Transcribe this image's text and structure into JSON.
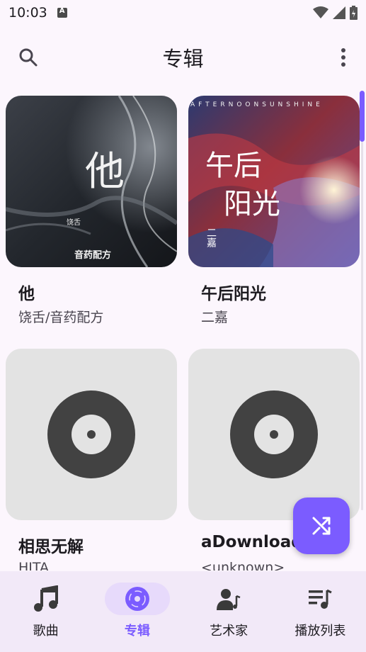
{
  "status_bar": {
    "time": "10:03"
  },
  "top_bar": {
    "title": "专辑"
  },
  "albums": [
    {
      "title": "他",
      "artist": "饶舌/音药配方",
      "cover_text": "他",
      "cover_sub": "饶舌",
      "cover_brand": "音药配方"
    },
    {
      "title": "午后阳光",
      "artist": "二嘉",
      "cover_text_1": "午后",
      "cover_text_2": "阳光",
      "cover_banner": "AFTERNOONSUNSHINE",
      "cover_sub": "二嘉"
    },
    {
      "title": "相思无解",
      "artist": "HITA"
    },
    {
      "title": "aDownload",
      "artist": "<unknown>"
    }
  ],
  "bottom_nav": [
    {
      "label": "歌曲",
      "icon": "music-note-icon"
    },
    {
      "label": "专辑",
      "icon": "album-disc-icon",
      "active": true
    },
    {
      "label": "艺术家",
      "icon": "artist-icon"
    },
    {
      "label": "播放列表",
      "icon": "playlist-icon"
    }
  ],
  "colors": {
    "accent": "#7B5CFF",
    "background": "#FCF6FD",
    "nav_bg": "#F2E9F8",
    "nav_active": "#E7DAFB"
  }
}
